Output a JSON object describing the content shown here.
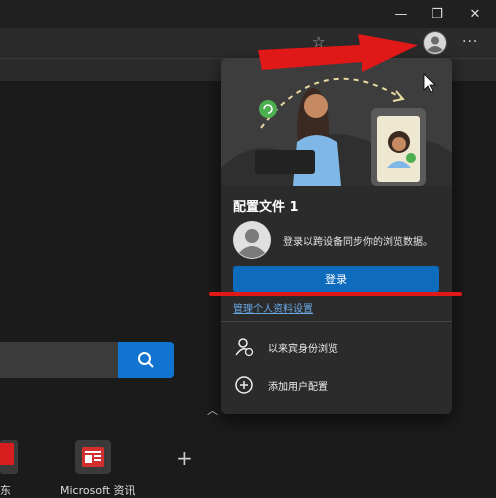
{
  "window": {
    "minimize": "—",
    "restore": "❐",
    "close": "✕"
  },
  "toolbar": {
    "more": "···"
  },
  "profile_panel": {
    "title": "配置文件 1",
    "signin_prompt": "登录以跨设备同步你的浏览数据。",
    "signin_button": "登录",
    "manage_link": "管理个人资料设置",
    "menu": [
      {
        "label": "以来宾身份浏览",
        "icon": "guest-icon"
      },
      {
        "label": "添加用户配置",
        "icon": "add-circle-icon"
      }
    ]
  },
  "new_tab": {
    "tiles": [
      {
        "label": "东",
        "icon": "jd-logo"
      },
      {
        "label": "Microsoft 资讯",
        "icon": "ms-news-icon"
      }
    ],
    "add_tile": "+"
  },
  "colors": {
    "accent": "#0f6cbd",
    "annotation_red": "#e01818"
  }
}
